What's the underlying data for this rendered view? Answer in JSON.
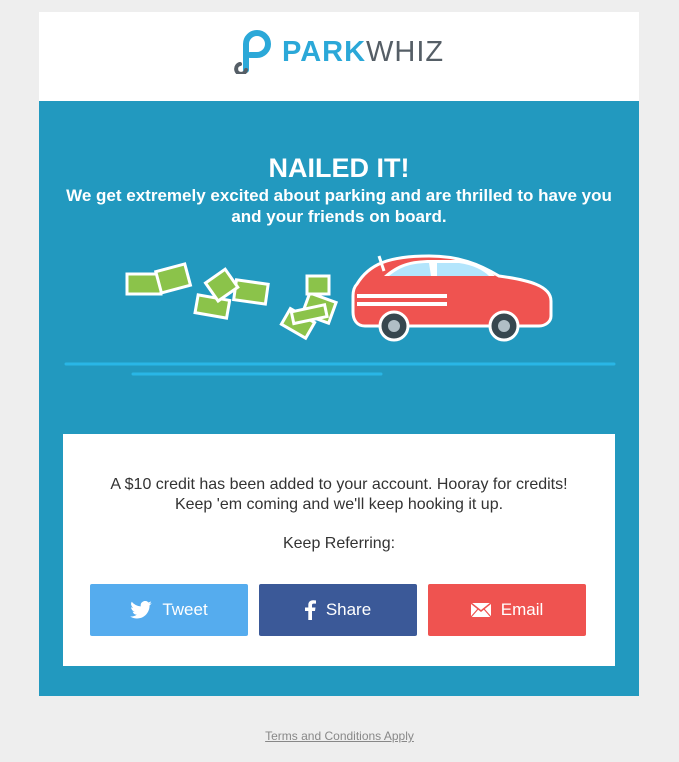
{
  "brand": {
    "park": "PARK",
    "whiz": "WHIZ",
    "accent": "#2ba8d8",
    "dark": "#555e66"
  },
  "hero": {
    "title": "NAILED IT!",
    "subtitle": "We get extremely excited about parking and are thrilled to have you and your friends on board.",
    "background": "#2299bf",
    "illustration_icons": [
      "flying-money-icon",
      "red-car-icon"
    ]
  },
  "panel": {
    "line1": "A $10 credit has been added to your account. Hooray for credits!",
    "line2": "Keep 'em coming and we'll keep hooking it up.",
    "keep_referring": "Keep Referring:"
  },
  "buttons": {
    "tweet": {
      "label": "Tweet",
      "icon": "twitter-bird-icon",
      "color": "#55acee"
    },
    "share": {
      "label": "Share",
      "icon": "facebook-f-icon",
      "color": "#3b5998"
    },
    "email": {
      "label": "Email",
      "icon": "envelope-icon",
      "color": "#ef5350"
    }
  },
  "footer": {
    "terms": "Terms and Conditions Apply"
  }
}
